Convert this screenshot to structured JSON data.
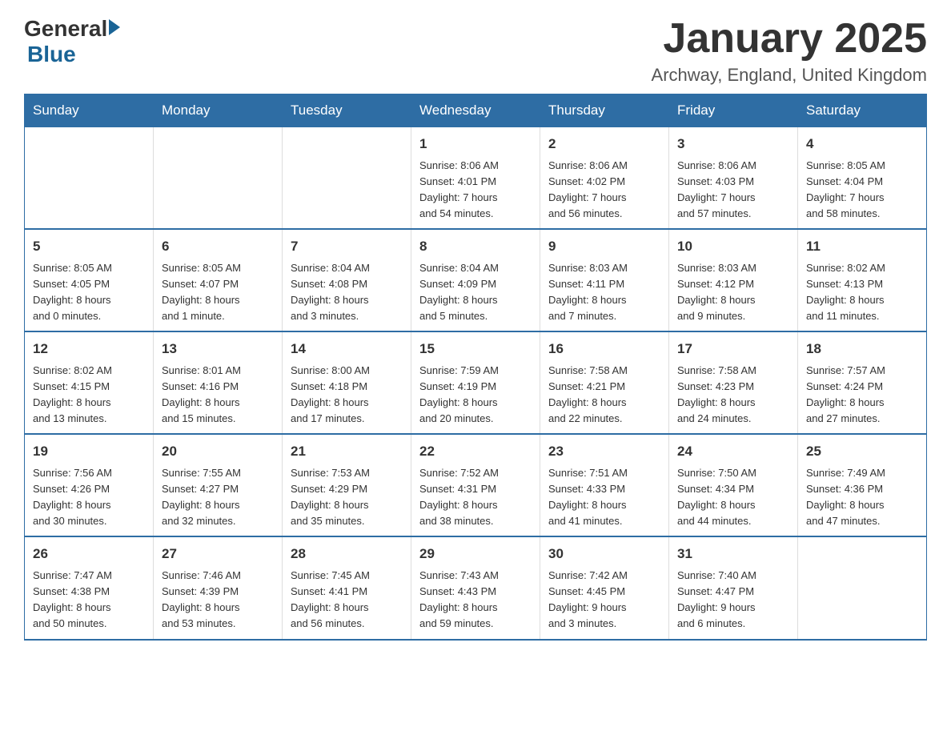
{
  "header": {
    "logo_general": "General",
    "logo_blue": "Blue",
    "title": "January 2025",
    "subtitle": "Archway, England, United Kingdom"
  },
  "weekdays": [
    "Sunday",
    "Monday",
    "Tuesday",
    "Wednesday",
    "Thursday",
    "Friday",
    "Saturday"
  ],
  "weeks": [
    [
      {
        "day": "",
        "info": ""
      },
      {
        "day": "",
        "info": ""
      },
      {
        "day": "",
        "info": ""
      },
      {
        "day": "1",
        "info": "Sunrise: 8:06 AM\nSunset: 4:01 PM\nDaylight: 7 hours\nand 54 minutes."
      },
      {
        "day": "2",
        "info": "Sunrise: 8:06 AM\nSunset: 4:02 PM\nDaylight: 7 hours\nand 56 minutes."
      },
      {
        "day": "3",
        "info": "Sunrise: 8:06 AM\nSunset: 4:03 PM\nDaylight: 7 hours\nand 57 minutes."
      },
      {
        "day": "4",
        "info": "Sunrise: 8:05 AM\nSunset: 4:04 PM\nDaylight: 7 hours\nand 58 minutes."
      }
    ],
    [
      {
        "day": "5",
        "info": "Sunrise: 8:05 AM\nSunset: 4:05 PM\nDaylight: 8 hours\nand 0 minutes."
      },
      {
        "day": "6",
        "info": "Sunrise: 8:05 AM\nSunset: 4:07 PM\nDaylight: 8 hours\nand 1 minute."
      },
      {
        "day": "7",
        "info": "Sunrise: 8:04 AM\nSunset: 4:08 PM\nDaylight: 8 hours\nand 3 minutes."
      },
      {
        "day": "8",
        "info": "Sunrise: 8:04 AM\nSunset: 4:09 PM\nDaylight: 8 hours\nand 5 minutes."
      },
      {
        "day": "9",
        "info": "Sunrise: 8:03 AM\nSunset: 4:11 PM\nDaylight: 8 hours\nand 7 minutes."
      },
      {
        "day": "10",
        "info": "Sunrise: 8:03 AM\nSunset: 4:12 PM\nDaylight: 8 hours\nand 9 minutes."
      },
      {
        "day": "11",
        "info": "Sunrise: 8:02 AM\nSunset: 4:13 PM\nDaylight: 8 hours\nand 11 minutes."
      }
    ],
    [
      {
        "day": "12",
        "info": "Sunrise: 8:02 AM\nSunset: 4:15 PM\nDaylight: 8 hours\nand 13 minutes."
      },
      {
        "day": "13",
        "info": "Sunrise: 8:01 AM\nSunset: 4:16 PM\nDaylight: 8 hours\nand 15 minutes."
      },
      {
        "day": "14",
        "info": "Sunrise: 8:00 AM\nSunset: 4:18 PM\nDaylight: 8 hours\nand 17 minutes."
      },
      {
        "day": "15",
        "info": "Sunrise: 7:59 AM\nSunset: 4:19 PM\nDaylight: 8 hours\nand 20 minutes."
      },
      {
        "day": "16",
        "info": "Sunrise: 7:58 AM\nSunset: 4:21 PM\nDaylight: 8 hours\nand 22 minutes."
      },
      {
        "day": "17",
        "info": "Sunrise: 7:58 AM\nSunset: 4:23 PM\nDaylight: 8 hours\nand 24 minutes."
      },
      {
        "day": "18",
        "info": "Sunrise: 7:57 AM\nSunset: 4:24 PM\nDaylight: 8 hours\nand 27 minutes."
      }
    ],
    [
      {
        "day": "19",
        "info": "Sunrise: 7:56 AM\nSunset: 4:26 PM\nDaylight: 8 hours\nand 30 minutes."
      },
      {
        "day": "20",
        "info": "Sunrise: 7:55 AM\nSunset: 4:27 PM\nDaylight: 8 hours\nand 32 minutes."
      },
      {
        "day": "21",
        "info": "Sunrise: 7:53 AM\nSunset: 4:29 PM\nDaylight: 8 hours\nand 35 minutes."
      },
      {
        "day": "22",
        "info": "Sunrise: 7:52 AM\nSunset: 4:31 PM\nDaylight: 8 hours\nand 38 minutes."
      },
      {
        "day": "23",
        "info": "Sunrise: 7:51 AM\nSunset: 4:33 PM\nDaylight: 8 hours\nand 41 minutes."
      },
      {
        "day": "24",
        "info": "Sunrise: 7:50 AM\nSunset: 4:34 PM\nDaylight: 8 hours\nand 44 minutes."
      },
      {
        "day": "25",
        "info": "Sunrise: 7:49 AM\nSunset: 4:36 PM\nDaylight: 8 hours\nand 47 minutes."
      }
    ],
    [
      {
        "day": "26",
        "info": "Sunrise: 7:47 AM\nSunset: 4:38 PM\nDaylight: 8 hours\nand 50 minutes."
      },
      {
        "day": "27",
        "info": "Sunrise: 7:46 AM\nSunset: 4:39 PM\nDaylight: 8 hours\nand 53 minutes."
      },
      {
        "day": "28",
        "info": "Sunrise: 7:45 AM\nSunset: 4:41 PM\nDaylight: 8 hours\nand 56 minutes."
      },
      {
        "day": "29",
        "info": "Sunrise: 7:43 AM\nSunset: 4:43 PM\nDaylight: 8 hours\nand 59 minutes."
      },
      {
        "day": "30",
        "info": "Sunrise: 7:42 AM\nSunset: 4:45 PM\nDaylight: 9 hours\nand 3 minutes."
      },
      {
        "day": "31",
        "info": "Sunrise: 7:40 AM\nSunset: 4:47 PM\nDaylight: 9 hours\nand 6 minutes."
      },
      {
        "day": "",
        "info": ""
      }
    ]
  ]
}
